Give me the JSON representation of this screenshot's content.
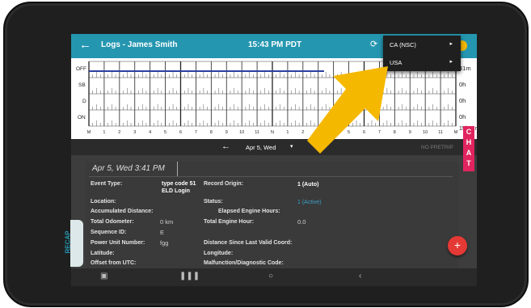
{
  "app": {
    "title": "Logs - James Smith",
    "time": "15:43 PM PDT",
    "back_icon": "arrow-left-icon",
    "refresh_icon": "refresh-icon"
  },
  "menu": {
    "items": [
      {
        "label": "CA (NSC)",
        "arrow": "▸"
      },
      {
        "label": "USA",
        "arrow": "▸"
      }
    ]
  },
  "graph": {
    "rows": [
      "OFF",
      "SB",
      "D",
      "ON"
    ],
    "hours": [
      "M",
      "1",
      "2",
      "3",
      "4",
      "5",
      "6",
      "7",
      "8",
      "9",
      "10",
      "11",
      "N",
      "1",
      "2",
      "3",
      "4",
      "5",
      "6",
      "7",
      "8",
      "9",
      "10",
      "11",
      "M"
    ],
    "totals": [
      "41m",
      "0h",
      "0h",
      "0h",
      "15h41m"
    ],
    "line_color": "#2b3fa0"
  },
  "chat": {
    "letters": [
      "C",
      "H",
      "A",
      "T"
    ]
  },
  "nav": {
    "date": "Apr 5, Wed",
    "dropdown": "▾",
    "pretrip": "NO PRETRIP"
  },
  "details": {
    "date_time": "Apr 5, Wed 3:41 PM",
    "event_type_label": "Event Type:",
    "event_type_value": "type code 51 ELD Login",
    "record_origin_label": "Record Origin:",
    "record_origin_value": "1 (Auto)",
    "location_label": "Location:",
    "status_label": "Status:",
    "status_value": "1 (Active)",
    "accum_distance_label": "Accumulated Distance:",
    "elapsed_hours_label": "Elapsed Engine Hours:",
    "total_odometer_label": "Total Odometer:",
    "total_odometer_value": "0 km",
    "total_engine_hour_label": "Total Engine Hour:",
    "total_engine_hour_value": "0.0",
    "sequence_id_label": "Sequence ID:",
    "sequence_id_value": "E",
    "power_unit_label": "Power Unit Number:",
    "power_unit_value": "fgg",
    "distance_since_label": "Distance Since Last Valid Coord:",
    "latitude_label": "Latitude:",
    "longitude_label": "Longitude:",
    "offset_utc_label": "Offset from UTC:",
    "malfunction_label": "Malfunction/Diagnostic Code:"
  },
  "recap": {
    "label": "RECAP"
  },
  "fab": {
    "label": "+"
  },
  "colors": {
    "accent": "#2596b0",
    "chat": "#e0245e",
    "fab": "#e53935",
    "arrow": "#f5b800"
  }
}
